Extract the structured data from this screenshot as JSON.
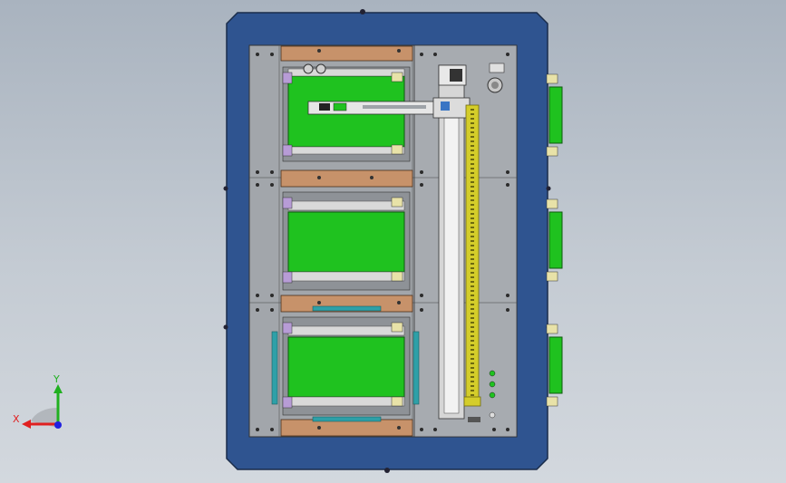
{
  "viewport": {
    "background": "#bfc7d0",
    "frame_color": "#2f5490",
    "plate_color": "#9fa3a8",
    "green_color": "#1fc21f",
    "wood_color": "#c7926a",
    "yellow_color": "#d4cd2a",
    "teal_color": "#2ea0a8"
  },
  "triad": {
    "x_label": "X",
    "y_label": "Y",
    "x_color": "#e02020",
    "y_color": "#20b020",
    "z_color": "#2020e0"
  }
}
